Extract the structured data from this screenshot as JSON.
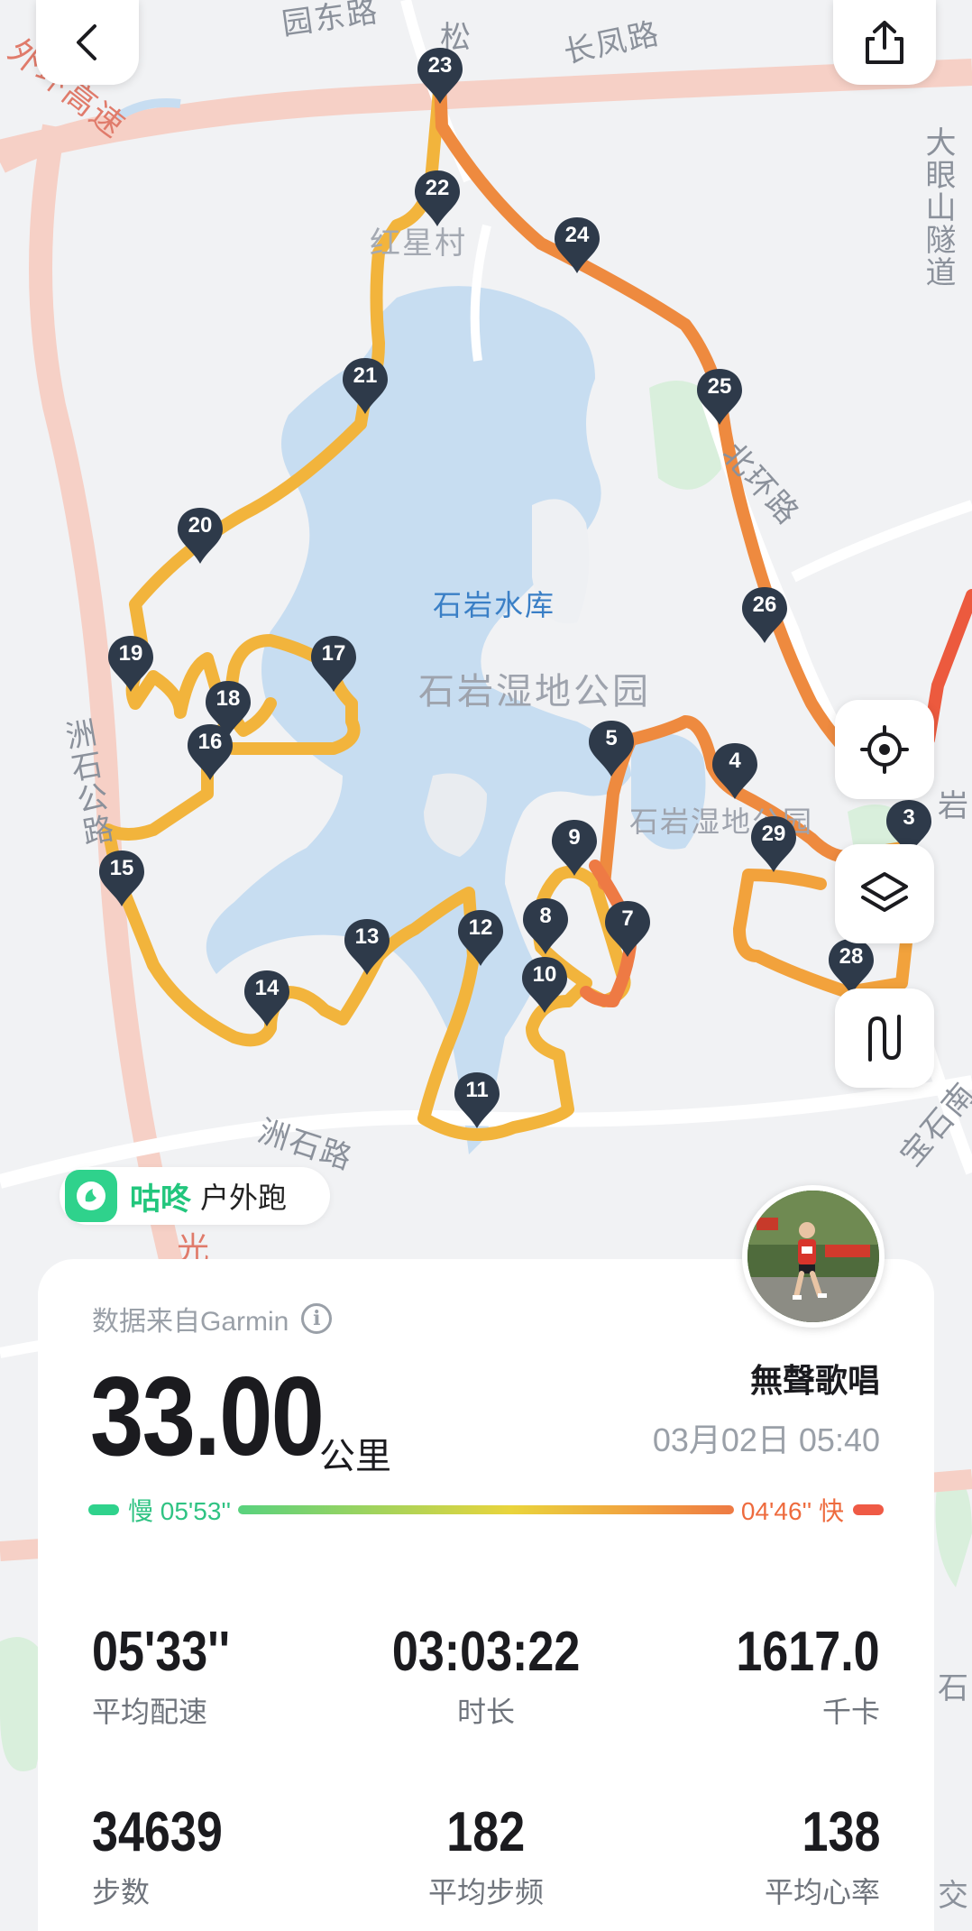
{
  "map": {
    "labels": {
      "reservoir": "石岩水库",
      "wetland_park_main": "石岩湿地公园",
      "wetland_park_small": "石岩湿地公园",
      "changfeng_road": "长凤路",
      "north_ring_road": "北环路",
      "zhoushi_road_bottom": "洲石路",
      "zhoushi_road_left": "洲石公路",
      "hongxing_village": "红星村",
      "big_eye_tunnel": "大眼山隧道",
      "outer_ring_highway": "外环高速",
      "east_road_top": "园东路",
      "song_top": "松",
      "baoshi_south": "宝石南",
      "jiao_right": "交",
      "shi_right": "石",
      "guang_bottom": "光",
      "yan_right": "岩"
    },
    "km_markers": [
      "3",
      "4",
      "5",
      "7",
      "8",
      "9",
      "10",
      "11",
      "12",
      "13",
      "14",
      "15",
      "16",
      "17",
      "18",
      "19",
      "20",
      "21",
      "22",
      "23",
      "24",
      "25",
      "26",
      "28",
      "29"
    ],
    "marker_color": "#2e3a4a",
    "route_colors": {
      "slow": "#f2b43c",
      "mid": "#f29a3c",
      "fast": "#ec6e3e"
    }
  },
  "brand": {
    "name": "咕咚",
    "sport": "户外跑",
    "color": "#2fd28c"
  },
  "card": {
    "source": "数据来自Garmin",
    "info_icon": "i",
    "distance": "33.00",
    "unit": "公里",
    "username": "無聲歌唱",
    "datetime": "03月02日 05:40",
    "pace_slow": "慢 05'53''",
    "pace_fast": "04'46'' 快",
    "stats": [
      {
        "value": "05'33''",
        "label": "平均配速"
      },
      {
        "value": "03:03:22",
        "label": "时长"
      },
      {
        "value": "1617.0",
        "label": "千卡"
      },
      {
        "value": "34639",
        "label": "步数"
      },
      {
        "value": "182",
        "label": "平均步频"
      },
      {
        "value": "138",
        "label": "平均心率"
      }
    ]
  },
  "buttons": {
    "back": "back-arrow-icon",
    "share": "share-icon",
    "locate": "locate-icon",
    "layers": "layers-icon",
    "route": "route-icon"
  }
}
